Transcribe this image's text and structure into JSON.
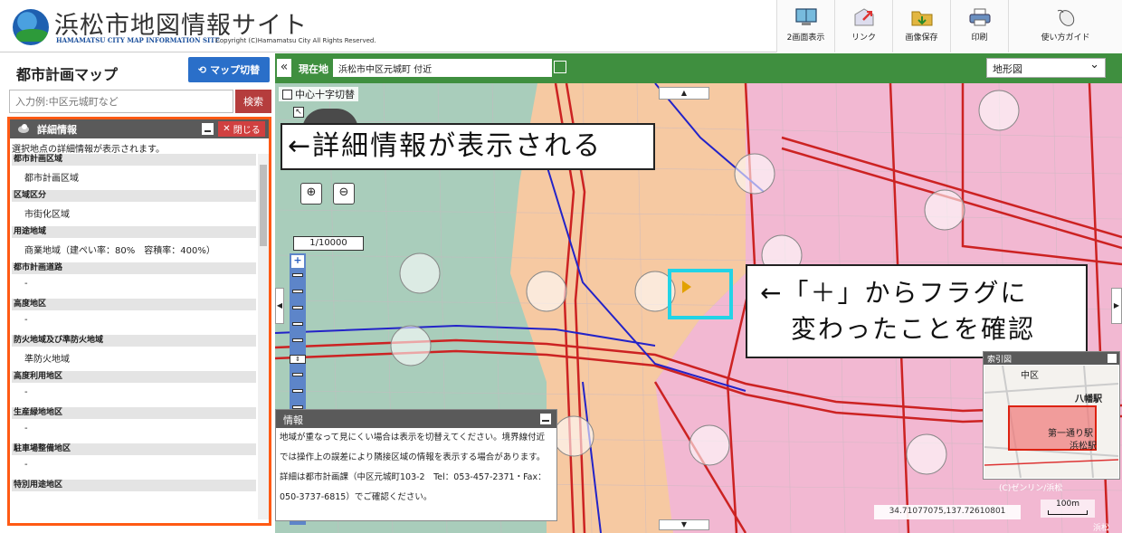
{
  "header": {
    "title": "浜松市地図情報サイト",
    "subtitle": "HAMAMATSU CITY MAP INFORMATION SITE",
    "copyright": "Copyright (C)Hamamatsu City All Rights Reserved.",
    "tools": [
      {
        "label": "2画面表示",
        "icon": "dual-screen-icon"
      },
      {
        "label": "リンク",
        "icon": "link-icon"
      },
      {
        "label": "画像保存",
        "icon": "folder-save-icon"
      },
      {
        "label": "印刷",
        "icon": "printer-icon"
      },
      {
        "label": "使い方ガイド",
        "icon": "mouse-icon"
      }
    ]
  },
  "sidebar": {
    "title": "都市計画マップ",
    "switch_label": "マップ切替",
    "search_placeholder": "入力例:中区元城町など",
    "search_button": "検索",
    "detail": {
      "title": "詳細情報",
      "close_label": "閉じる",
      "description": "選択地点の詳細情報が表示されます。",
      "items": [
        {
          "label": "都市計画区域",
          "value": "都市計画区域"
        },
        {
          "label": "区域区分",
          "value": "市街化区域"
        },
        {
          "label": "用途地域",
          "value": "商業地域（建ぺい率：80%　容積率：400%）"
        },
        {
          "label": "都市計画道路",
          "value": "-"
        },
        {
          "label": "高度地区",
          "value": "-"
        },
        {
          "label": "防火地域及び準防火地域",
          "value": "準防火地域"
        },
        {
          "label": "高度利用地区",
          "value": "-"
        },
        {
          "label": "生産緑地地区",
          "value": "-"
        },
        {
          "label": "駐車場整備地区",
          "value": "-"
        },
        {
          "label": "特別用途地区",
          "value": ""
        }
      ]
    }
  },
  "mapbar": {
    "collapse": "«",
    "location_label": "現在地",
    "location_value": "浜松市中区元城町 付近",
    "map_type": "地形図"
  },
  "map": {
    "crosshair_toggle": "中心十字切替",
    "scale": "1/10000",
    "callout_1": "←詳細情報が表示される",
    "callout_2_line1": "←「＋」からフラグに",
    "callout_2_line2": "変わったことを確認",
    "info": {
      "title": "情報",
      "text": "地域が重なって見にくい場合は表示を切替えてください。境界線付近では操作上の誤差により隣接区域の情報を表示する場合があります。詳細は都市計画課（中区元城町103-2　Tel：053-457-2371・Fax：050-3737-6815）でご確認ください。"
    },
    "overview": {
      "title": "索引図",
      "labels": [
        "中区",
        "八幡駅",
        "第一通り駅",
        "浜松駅"
      ]
    },
    "credit": "(C)ゼンリン/浜松",
    "coordinates": "34.71077075,137.72610801",
    "scale_bar": "100m",
    "corner_label": "浜松"
  },
  "colors": {
    "header_bg": "#ffffff",
    "accent_blue": "#2a6fc9",
    "search_red": "#b53d3d",
    "mapbar_green": "#3f8f3f",
    "highlight_orange": "#ff5a14",
    "highlight_cyan": "#22d3e6",
    "commercial_pink": "#f2b8d2"
  }
}
